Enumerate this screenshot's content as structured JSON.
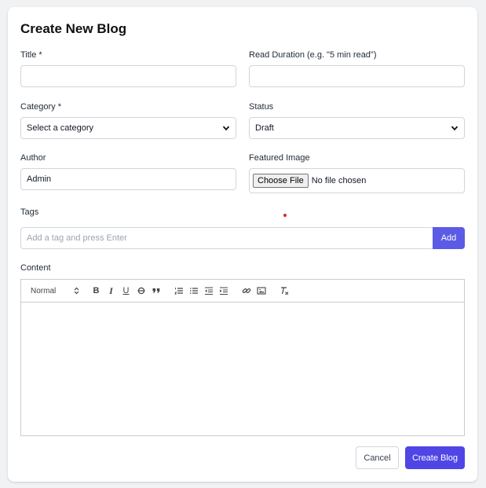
{
  "form": {
    "heading": "Create New Blog",
    "title_label": "Title *",
    "title_value": "",
    "read_duration_label": "Read Duration (e.g. \"5 min read\")",
    "read_duration_value": "",
    "category_label": "Category *",
    "category_selected": "Select a category",
    "status_label": "Status",
    "status_selected": "Draft",
    "author_label": "Author",
    "author_value": "Admin",
    "featured_image_label": "Featured Image",
    "choose_file_label": "Choose File",
    "no_file_text": "No file chosen",
    "tags_label": "Tags",
    "tags_placeholder": "Add a tag and press Enter",
    "add_tag_label": "Add",
    "content_label": "Content"
  },
  "editor": {
    "heading_select": "Normal",
    "toolbar_icons": [
      "bold-icon",
      "italic-icon",
      "underline-icon",
      "strike-icon",
      "blockquote-icon",
      "ordered-list-icon",
      "bullet-list-icon",
      "outdent-icon",
      "indent-icon",
      "link-icon",
      "image-icon",
      "clear-format-icon"
    ]
  },
  "actions": {
    "cancel_label": "Cancel",
    "create_label": "Create Blog"
  },
  "colors": {
    "primary": "#4f46e5",
    "add_button": "#5b5be6",
    "card_bg": "#ffffff",
    "page_bg": "#f1f2f4"
  }
}
